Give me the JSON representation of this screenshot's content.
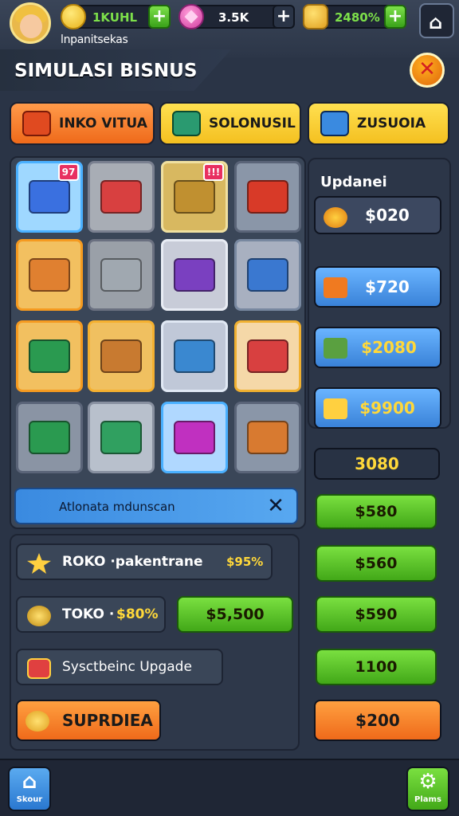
{
  "header": {
    "player_name": "lnpanitsekas",
    "resources": [
      {
        "icon": "gold-coin-icon",
        "value": "1KUHL",
        "color": "#7de04a"
      },
      {
        "icon": "gem-icon",
        "value": "3.5K",
        "color": "#ffffff"
      },
      {
        "icon": "crown-icon",
        "value": "2480%",
        "color": "#7de04a"
      }
    ],
    "plus_symbol": "+",
    "home_glyph": "⌂"
  },
  "title": "SIMULASI BISNUS",
  "close_symbol": "✕",
  "tabs": [
    {
      "label": "INKO VITUA",
      "icon": "box-icon"
    },
    {
      "label": "SOLONUSIL",
      "icon": "crate-icon"
    },
    {
      "label": "ZUSUOIA",
      "icon": "cash-register-icon"
    }
  ],
  "grid": {
    "badges": [
      "97",
      "!!!"
    ],
    "items": [
      {
        "icon": "delivery-truck-icon",
        "bg": "#9fd8ff",
        "border": "#4ab0ff"
      },
      {
        "icon": "produce-crate-icon",
        "bg": "#a8adb5",
        "border": "#7a8090"
      },
      {
        "icon": "shopping-cart-icon",
        "bg": "#d8b860",
        "border": "#f0e0a0"
      },
      {
        "icon": "red-bin-icon",
        "bg": "#8a96a8",
        "border": "#5a6478"
      },
      {
        "icon": "boxes-icon",
        "bg": "#f2c060",
        "border": "#f59a20"
      },
      {
        "icon": "metal-cart-icon",
        "bg": "#9aa0a8",
        "border": "#6a7080"
      },
      {
        "icon": "shelves-icon",
        "bg": "#c8ccd8",
        "border": "#e8ecf4"
      },
      {
        "icon": "checkout-counter-icon",
        "bg": "#a8b0c0",
        "border": "#7888a0"
      },
      {
        "icon": "market-stall-icon",
        "bg": "#f2c060",
        "border": "#f59a20"
      },
      {
        "icon": "display-counter-icon",
        "bg": "#f0c060",
        "border": "#f5b030"
      },
      {
        "icon": "freezer-icon",
        "bg": "#c0c8d8",
        "border": "#e0e8f4"
      },
      {
        "icon": "grocery-cart-icon",
        "bg": "#f5d8a8",
        "border": "#f0b030"
      },
      {
        "icon": "veg-cart-icon",
        "bg": "#8a94a4",
        "border": "#5a6478"
      },
      {
        "icon": "fridge-display-icon",
        "bg": "#b8c0cc",
        "border": "#8890a0"
      },
      {
        "icon": "purple-basket-icon",
        "bg": "#b0d8ff",
        "border": "#4ab0ff"
      },
      {
        "icon": "wooden-chest-icon",
        "bg": "#8a96a8",
        "border": "#5a6478"
      }
    ]
  },
  "auto_bar": {
    "label": "Atlonata mdunscan",
    "close": "✕"
  },
  "upgrades": {
    "title": "Updanei",
    "buttons": [
      "$020",
      "$720",
      "$2080",
      "$9900",
      "3080"
    ]
  },
  "bottom_rows": [
    {
      "icon": "star-icon",
      "label": "ROKO ·pakentrane",
      "price": "$95%"
    },
    {
      "icon": "coin-stack-icon",
      "label": "TOKO ·",
      "price": "$80%",
      "button": "$5,500"
    },
    {
      "icon": "gift-icon",
      "label": "Sysctbeinc Upgade"
    },
    {
      "icon": "coin-bag-icon",
      "label": "SUPRDIEA"
    }
  ],
  "right_column": [
    "$580",
    "$560",
    "$590",
    "1100",
    "$200"
  ],
  "footer": {
    "left_label": "Skour",
    "right_label": "Plams"
  },
  "colors": {
    "background": "#2a3446",
    "green": "#42a818",
    "orange": "#ef6a1a",
    "yellow": "#f4c020",
    "blue": "#3a8ae0"
  }
}
